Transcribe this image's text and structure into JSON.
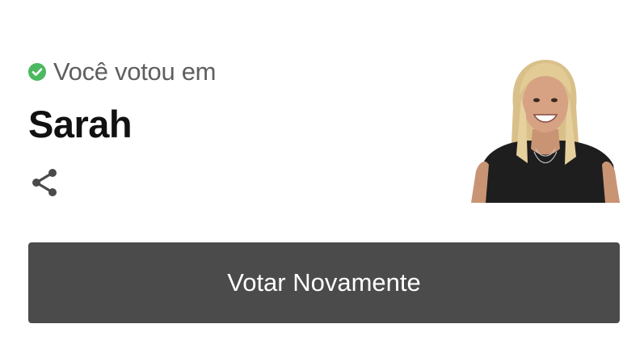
{
  "vote_status": {
    "label": "Você votou em",
    "icon": "check-circle-icon",
    "icon_color": "#4cb860"
  },
  "candidate": {
    "name": "Sarah"
  },
  "share": {
    "icon": "share-icon"
  },
  "actions": {
    "vote_again_label": "Votar Novamente",
    "button_color": "#4b4b4b"
  }
}
